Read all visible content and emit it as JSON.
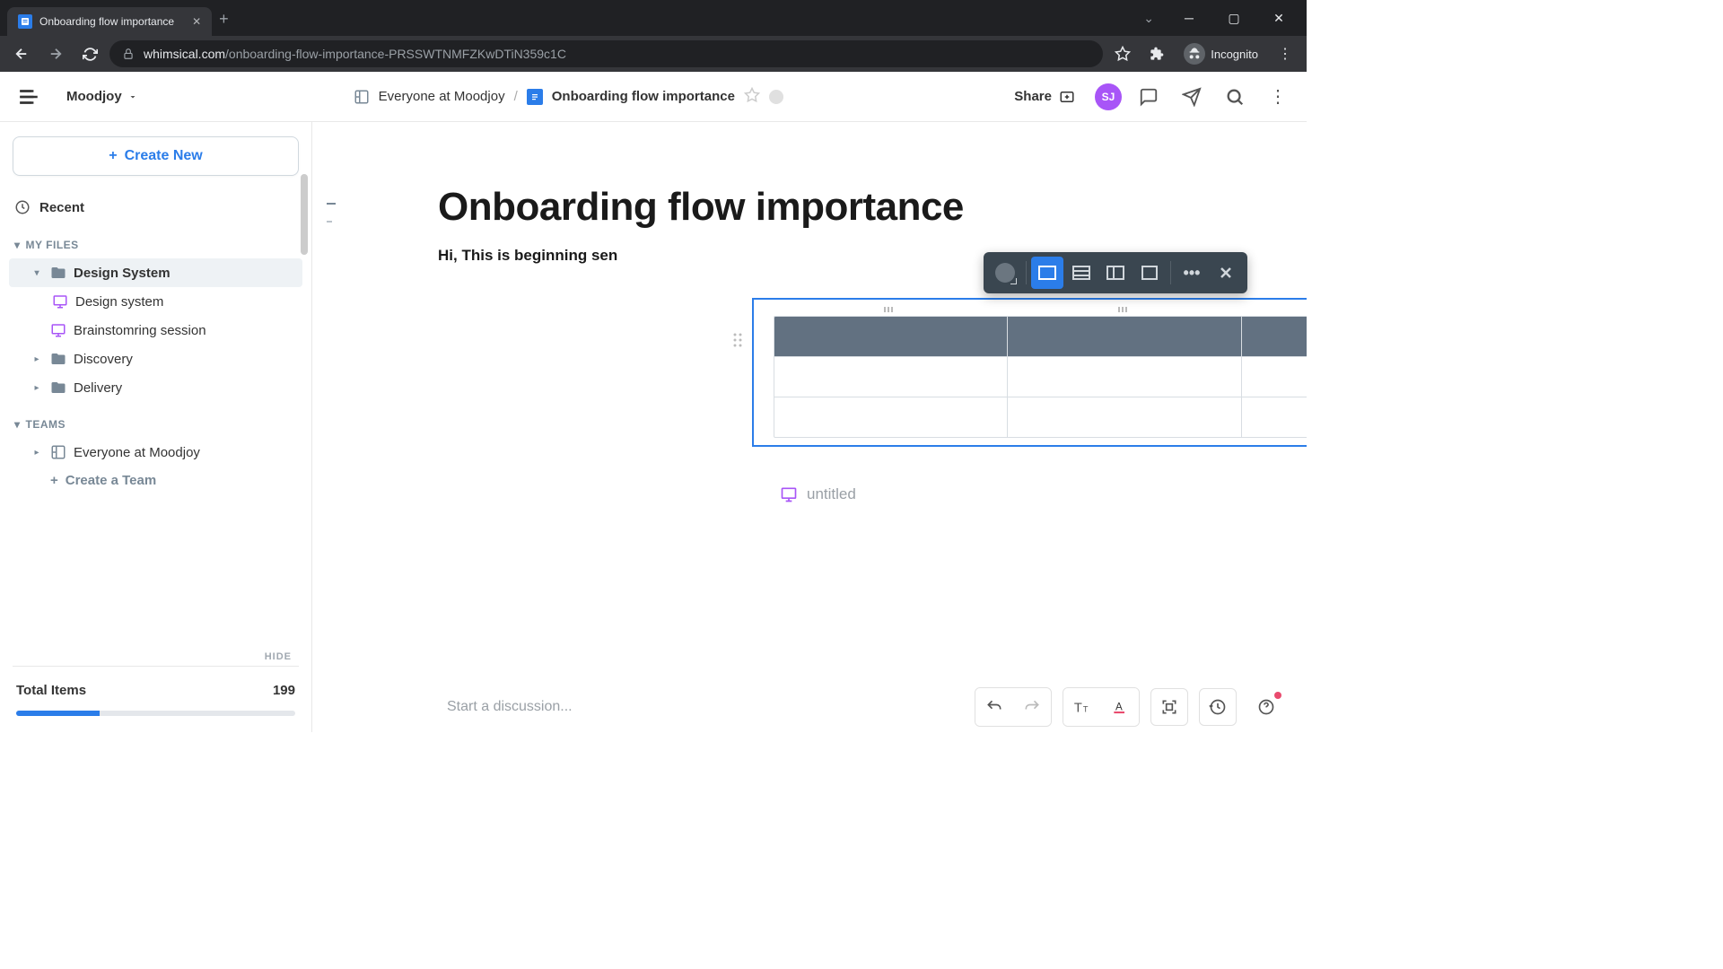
{
  "browser": {
    "tab_title": "Onboarding flow importance",
    "url_prefix": "whimsical.com",
    "url_path": "/onboarding-flow-importance-PRSSWTNMFZKwDTiN359c1C",
    "incognito_label": "Incognito"
  },
  "header": {
    "workspace": "Moodjoy",
    "breadcrumb_parent": "Everyone at Moodjoy",
    "breadcrumb_current": "Onboarding flow importance",
    "share": "Share",
    "avatar_initials": "SJ"
  },
  "sidebar": {
    "create_label": "Create New",
    "recent": "Recent",
    "section_my_files": "MY FILES",
    "section_teams": "TEAMS",
    "items": {
      "design_system_folder": "Design System",
      "design_system_board": "Design system",
      "brainstorming": "Brainstomring session",
      "discovery": "Discovery",
      "delivery": "Delivery",
      "team_everyone": "Everyone at Moodjoy",
      "create_team": "Create a Team"
    },
    "hide_label": "HIDE",
    "total_label": "Total Items",
    "total_value": "199"
  },
  "doc": {
    "title": "Onboarding flow importance",
    "para": "Hi, This is beginning sen",
    "untitled": "untitled",
    "discussion_placeholder": "Start a discussion..."
  }
}
